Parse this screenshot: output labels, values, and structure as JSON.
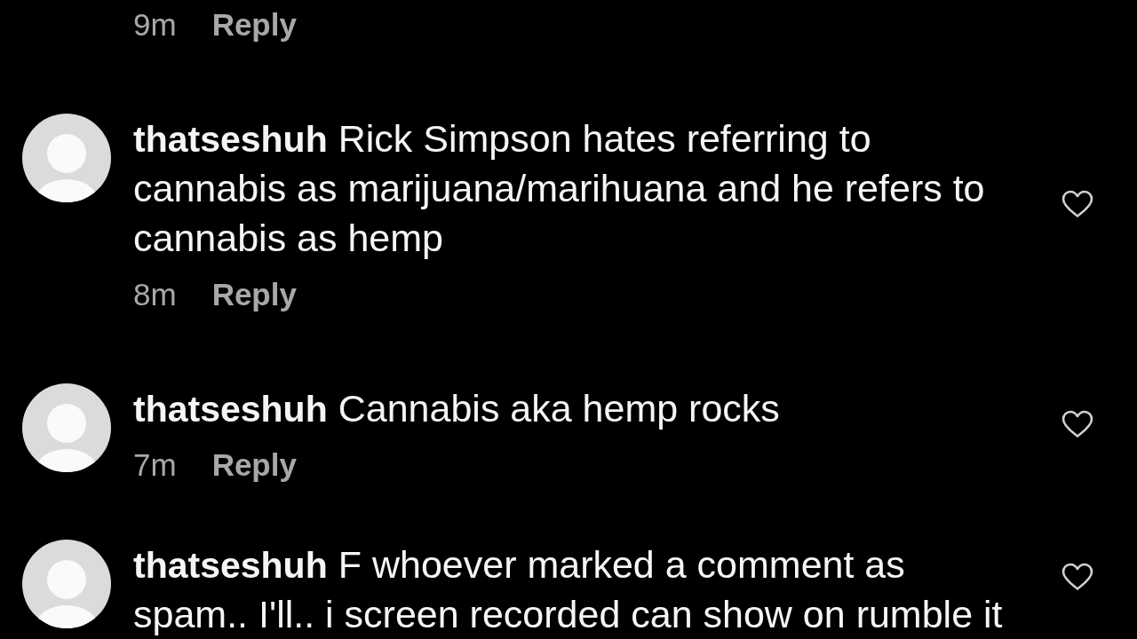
{
  "previous_comment": {
    "time": "9m",
    "reply": "Reply"
  },
  "comments": [
    {
      "username": "thatseshuh",
      "text": "Rick Simpson hates referring to cannabis as marijuana/marihuana and he refers to cannabis as hemp",
      "time": "8m",
      "reply": "Reply",
      "liked": false
    },
    {
      "username": "thatseshuh",
      "text": "Cannabis aka hemp rocks",
      "time": "7m",
      "reply": "Reply",
      "liked": false
    },
    {
      "username": "thatseshuh",
      "text": "F whoever marked a comment as spam.. I'll.. i screen recorded can show on rumble it",
      "liked": false
    }
  ]
}
